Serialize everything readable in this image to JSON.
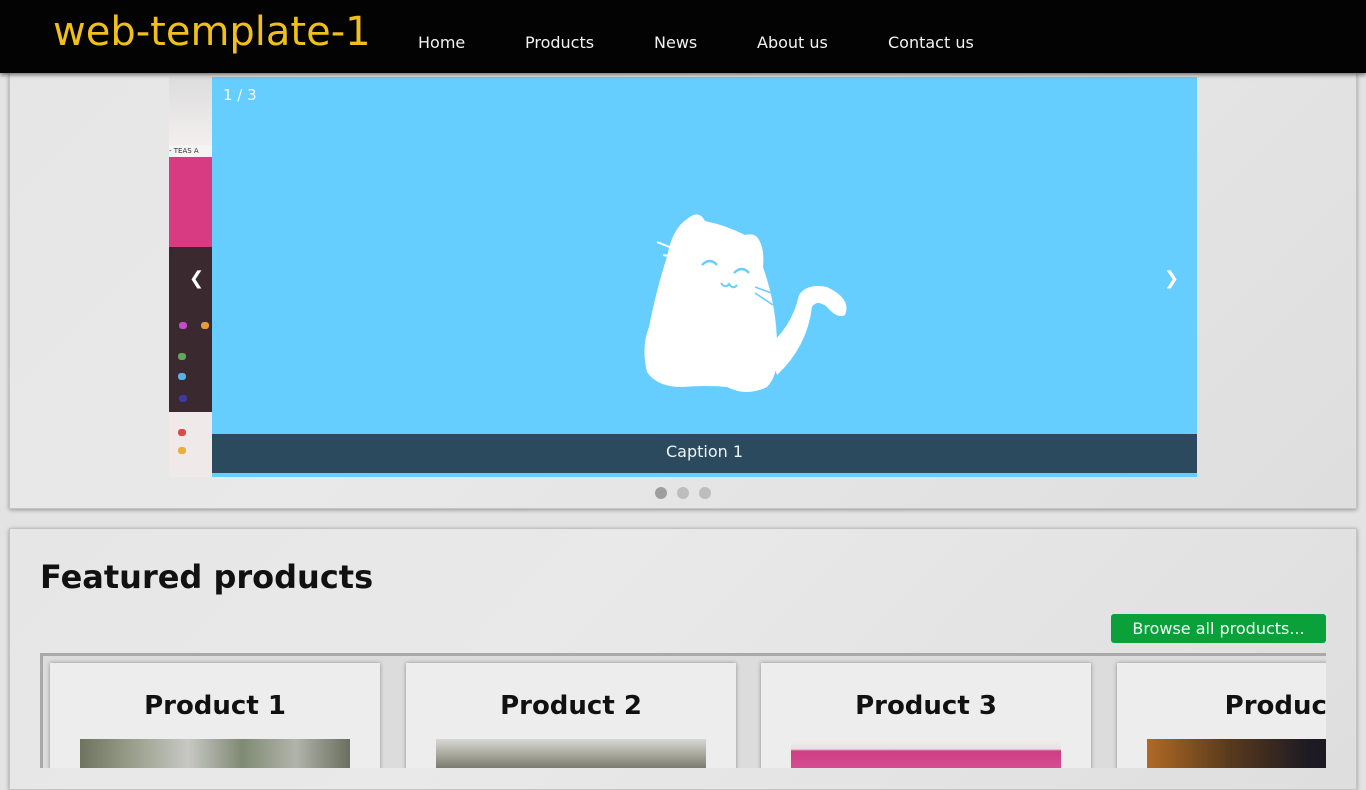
{
  "site": {
    "logo": "web-template-1"
  },
  "nav": {
    "items": [
      "Home",
      "Products",
      "News",
      "About us",
      "Contact us"
    ]
  },
  "slider": {
    "counter": "1 / 3",
    "caption": "Caption 1",
    "prev_arrow": "❮",
    "next_arrow": "❯",
    "current_slide": 1,
    "total_slides": 3,
    "slide_background": "#66cdff",
    "prev_image_sign": "- TEAS A"
  },
  "featured": {
    "title": "Featured products",
    "browse_label": "Browse all products...",
    "products": [
      {
        "name": "Product 1"
      },
      {
        "name": "Product 2"
      },
      {
        "name": "Product 3"
      },
      {
        "name": "Product"
      }
    ]
  },
  "colors": {
    "header_bg": "#030303",
    "logo": "#f1bf1c",
    "caption_bar": "#2b4a5d",
    "browse_button": "#0aa03a"
  },
  "icons": [
    "chevron-left-icon",
    "chevron-right-icon",
    "cat-illustration"
  ]
}
